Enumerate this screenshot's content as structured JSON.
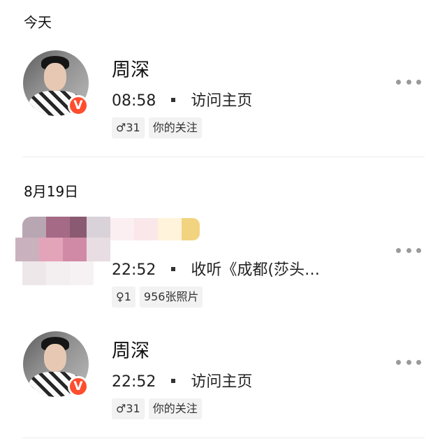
{
  "sections": [
    {
      "header": "今天",
      "items": [
        {
          "name": "周深",
          "time": "08:58",
          "action": "访问主页",
          "gender_icon": "male-icon",
          "gender_symbol": "♂",
          "age": "31",
          "tag": "你的关注",
          "verified_badge": "V",
          "more_icon": "more-horizontal-icon"
        }
      ]
    },
    {
      "header": "8月19日",
      "items": [
        {
          "name": "",
          "time": "22:52",
          "action": "收听《成都(莎头…",
          "gender_icon": "female-icon",
          "gender_symbol": "♀",
          "age": "1",
          "tag": "956张照片",
          "more_icon": "more-horizontal-icon"
        },
        {
          "name": "周深",
          "time": "22:52",
          "action": "访问主页",
          "gender_icon": "male-icon",
          "gender_symbol": "♂",
          "age": "31",
          "tag": "你的关注",
          "verified_badge": "V",
          "more_icon": "more-horizontal-icon"
        }
      ]
    }
  ],
  "colors": {
    "badge": "#ff4d2e",
    "tag_bg": "#f2f2f2",
    "divider": "#ececec",
    "dots": "#9a9a9a"
  }
}
